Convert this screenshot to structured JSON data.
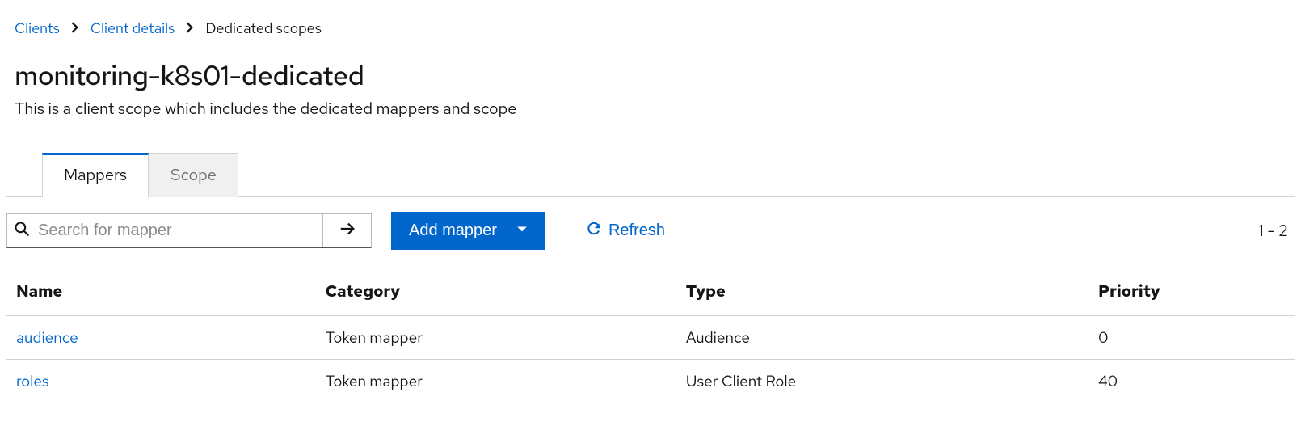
{
  "breadcrumb": {
    "clients": "Clients",
    "client_details": "Client details",
    "current": "Dedicated scopes"
  },
  "header": {
    "title": "monitoring-k8s01-dedicated",
    "subtitle": "This is a client scope which includes the dedicated mappers and scope"
  },
  "tabs": {
    "mappers": "Mappers",
    "scope": "Scope"
  },
  "toolbar": {
    "search_placeholder": "Search for mapper",
    "add_mapper": "Add mapper",
    "refresh": "Refresh"
  },
  "pagination": {
    "range": "1 - 2"
  },
  "table": {
    "headers": {
      "name": "Name",
      "category": "Category",
      "type": "Type",
      "priority": "Priority"
    },
    "rows": [
      {
        "name": "audience",
        "category": "Token mapper",
        "type": "Audience",
        "priority": "0"
      },
      {
        "name": "roles",
        "category": "Token mapper",
        "type": "User Client Role",
        "priority": "40"
      }
    ]
  }
}
